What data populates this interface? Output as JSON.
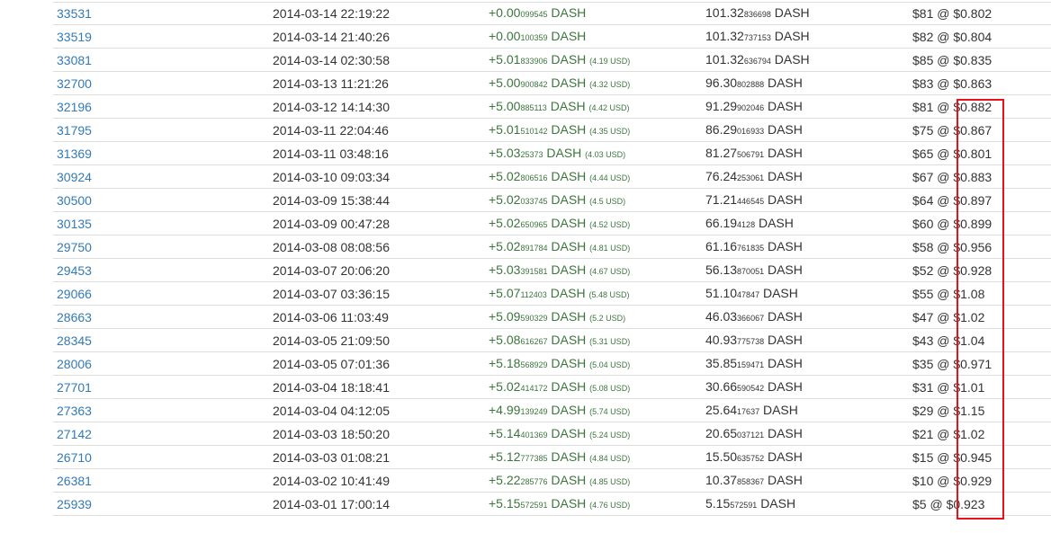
{
  "rows": [
    {
      "block": "33531",
      "time": "2014-03-14 22:19:22",
      "amt_main": "+0.00",
      "amt_small": "099545",
      "amt_unit": "DASH",
      "amt_usd": "",
      "bal_main": "101.32",
      "bal_small": "836698",
      "bal_unit": "DASH",
      "value": "$81 @ $0.802"
    },
    {
      "block": "33519",
      "time": "2014-03-14 21:40:26",
      "amt_main": "+0.00",
      "amt_small": "100359",
      "amt_unit": "DASH",
      "amt_usd": "",
      "bal_main": "101.32",
      "bal_small": "737153",
      "bal_unit": "DASH",
      "value": "$82 @ $0.804"
    },
    {
      "block": "33081",
      "time": "2014-03-14 02:30:58",
      "amt_main": "+5.01",
      "amt_small": "833906",
      "amt_unit": "DASH",
      "amt_usd": "(4.19 USD)",
      "bal_main": "101.32",
      "bal_small": "636794",
      "bal_unit": "DASH",
      "value": "$85 @ $0.835"
    },
    {
      "block": "32700",
      "time": "2014-03-13 11:21:26",
      "amt_main": "+5.00",
      "amt_small": "900842",
      "amt_unit": "DASH",
      "amt_usd": "(4.32 USD)",
      "bal_main": "96.30",
      "bal_small": "802888",
      "bal_unit": "DASH",
      "value": "$83 @ $0.863"
    },
    {
      "block": "32196",
      "time": "2014-03-12 14:14:30",
      "amt_main": "+5.00",
      "amt_small": "885113",
      "amt_unit": "DASH",
      "amt_usd": "(4.42 USD)",
      "bal_main": "91.29",
      "bal_small": "902046",
      "bal_unit": "DASH",
      "value": "$81 @ $0.882"
    },
    {
      "block": "31795",
      "time": "2014-03-11 22:04:46",
      "amt_main": "+5.01",
      "amt_small": "510142",
      "amt_unit": "DASH",
      "amt_usd": "(4.35 USD)",
      "bal_main": "86.29",
      "bal_small": "016933",
      "bal_unit": "DASH",
      "value": "$75 @ $0.867"
    },
    {
      "block": "31369",
      "time": "2014-03-11 03:48:16",
      "amt_main": "+5.03",
      "amt_small": "25373",
      "amt_unit": "DASH",
      "amt_usd": "(4.03 USD)",
      "bal_main": "81.27",
      "bal_small": "506791",
      "bal_unit": "DASH",
      "value": "$65 @ $0.801"
    },
    {
      "block": "30924",
      "time": "2014-03-10 09:03:34",
      "amt_main": "+5.02",
      "amt_small": "806516",
      "amt_unit": "DASH",
      "amt_usd": "(4.44 USD)",
      "bal_main": "76.24",
      "bal_small": "253061",
      "bal_unit": "DASH",
      "value": "$67 @ $0.883"
    },
    {
      "block": "30500",
      "time": "2014-03-09 15:38:44",
      "amt_main": "+5.02",
      "amt_small": "033745",
      "amt_unit": "DASH",
      "amt_usd": "(4.5 USD)",
      "bal_main": "71.21",
      "bal_small": "446545",
      "bal_unit": "DASH",
      "value": "$64 @ $0.897"
    },
    {
      "block": "30135",
      "time": "2014-03-09 00:47:28",
      "amt_main": "+5.02",
      "amt_small": "650965",
      "amt_unit": "DASH",
      "amt_usd": "(4.52 USD)",
      "bal_main": "66.19",
      "bal_small": "4128",
      "bal_unit": "DASH",
      "value": "$60 @ $0.899"
    },
    {
      "block": "29750",
      "time": "2014-03-08 08:08:56",
      "amt_main": "+5.02",
      "amt_small": "891784",
      "amt_unit": "DASH",
      "amt_usd": "(4.81 USD)",
      "bal_main": "61.16",
      "bal_small": "761835",
      "bal_unit": "DASH",
      "value": "$58 @ $0.956"
    },
    {
      "block": "29453",
      "time": "2014-03-07 20:06:20",
      "amt_main": "+5.03",
      "amt_small": "391581",
      "amt_unit": "DASH",
      "amt_usd": "(4.67 USD)",
      "bal_main": "56.13",
      "bal_small": "870051",
      "bal_unit": "DASH",
      "value": "$52 @ $0.928"
    },
    {
      "block": "29066",
      "time": "2014-03-07 03:36:15",
      "amt_main": "+5.07",
      "amt_small": "112403",
      "amt_unit": "DASH",
      "amt_usd": "(5.48 USD)",
      "bal_main": "51.10",
      "bal_small": "47847",
      "bal_unit": "DASH",
      "value": "$55 @ $1.08"
    },
    {
      "block": "28663",
      "time": "2014-03-06 11:03:49",
      "amt_main": "+5.09",
      "amt_small": "590329",
      "amt_unit": "DASH",
      "amt_usd": "(5.2 USD)",
      "bal_main": "46.03",
      "bal_small": "366067",
      "bal_unit": "DASH",
      "value": "$47 @ $1.02"
    },
    {
      "block": "28345",
      "time": "2014-03-05 21:09:50",
      "amt_main": "+5.08",
      "amt_small": "616267",
      "amt_unit": "DASH",
      "amt_usd": "(5.31 USD)",
      "bal_main": "40.93",
      "bal_small": "775738",
      "bal_unit": "DASH",
      "value": "$43 @ $1.04"
    },
    {
      "block": "28006",
      "time": "2014-03-05 07:01:36",
      "amt_main": "+5.18",
      "amt_small": "568929",
      "amt_unit": "DASH",
      "amt_usd": "(5.04 USD)",
      "bal_main": "35.85",
      "bal_small": "159471",
      "bal_unit": "DASH",
      "value": "$35 @ $0.971"
    },
    {
      "block": "27701",
      "time": "2014-03-04 18:18:41",
      "amt_main": "+5.02",
      "amt_small": "414172",
      "amt_unit": "DASH",
      "amt_usd": "(5.08 USD)",
      "bal_main": "30.66",
      "bal_small": "590542",
      "bal_unit": "DASH",
      "value": "$31 @ $1.01"
    },
    {
      "block": "27363",
      "time": "2014-03-04 04:12:05",
      "amt_main": "+4.99",
      "amt_small": "139249",
      "amt_unit": "DASH",
      "amt_usd": "(5.74 USD)",
      "bal_main": "25.64",
      "bal_small": "17637",
      "bal_unit": "DASH",
      "value": "$29 @ $1.15"
    },
    {
      "block": "27142",
      "time": "2014-03-03 18:50:20",
      "amt_main": "+5.14",
      "amt_small": "401369",
      "amt_unit": "DASH",
      "amt_usd": "(5.24 USD)",
      "bal_main": "20.65",
      "bal_small": "037121",
      "bal_unit": "DASH",
      "value": "$21 @ $1.02"
    },
    {
      "block": "26710",
      "time": "2014-03-03 01:08:21",
      "amt_main": "+5.12",
      "amt_small": "777385",
      "amt_unit": "DASH",
      "amt_usd": "(4.84 USD)",
      "bal_main": "15.50",
      "bal_small": "635752",
      "bal_unit": "DASH",
      "value": "$15 @ $0.945"
    },
    {
      "block": "26381",
      "time": "2014-03-02 10:41:49",
      "amt_main": "+5.22",
      "amt_small": "285776",
      "amt_unit": "DASH",
      "amt_usd": "(4.85 USD)",
      "bal_main": "10.37",
      "bal_small": "858367",
      "bal_unit": "DASH",
      "value": "$10 @ $0.929"
    },
    {
      "block": "25939",
      "time": "2014-03-01 17:00:14",
      "amt_main": "+5.15",
      "amt_small": "572591",
      "amt_unit": "DASH",
      "amt_usd": "(4.76 USD)",
      "bal_main": "5.15",
      "bal_small": "572591",
      "bal_unit": "DASH",
      "value": "$5 @ $0.923"
    }
  ],
  "colors": {
    "link": "#337ab7",
    "amount": "#3c763d",
    "text": "#333333",
    "row_border": "#dddddd",
    "highlight": "#e8121b"
  }
}
